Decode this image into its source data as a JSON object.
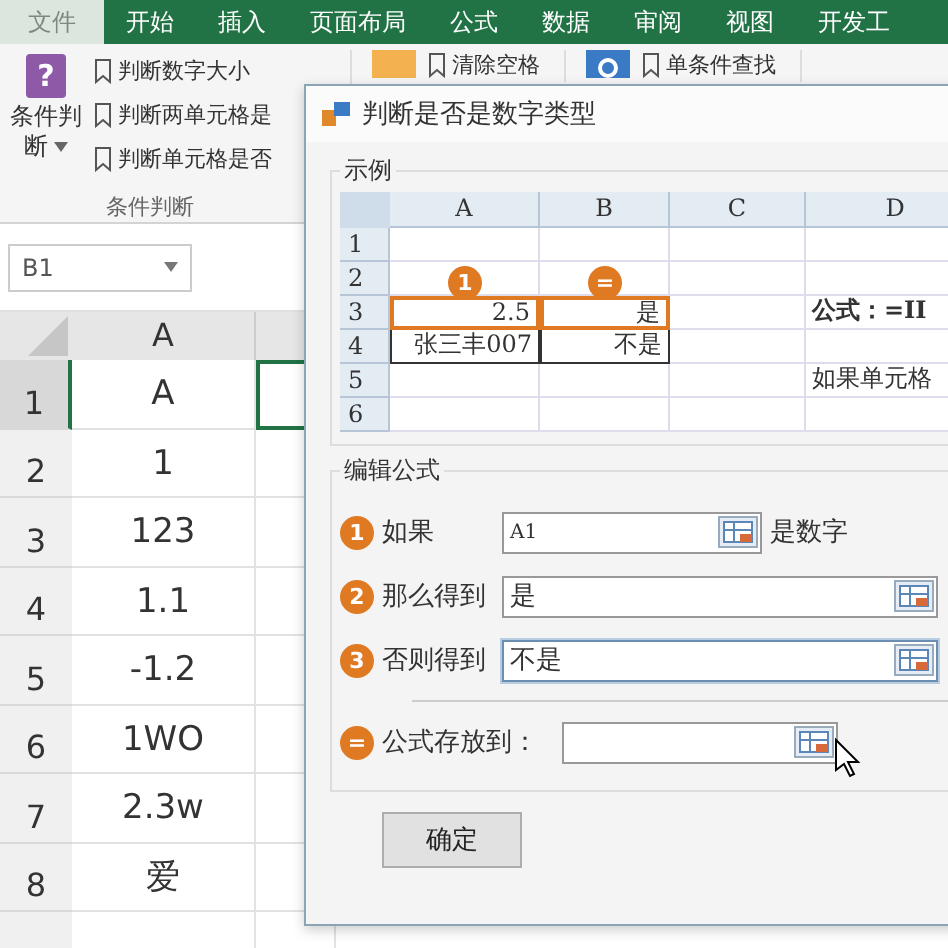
{
  "ribbon_tabs": [
    {
      "label": "文件",
      "kind": "file"
    },
    {
      "label": "开始",
      "kind": "tab"
    },
    {
      "label": "插入",
      "kind": "tab"
    },
    {
      "label": "页面布局",
      "kind": "tab"
    },
    {
      "label": "公式",
      "kind": "tab"
    },
    {
      "label": "数据",
      "kind": "tab"
    },
    {
      "label": "审阅",
      "kind": "tab"
    },
    {
      "label": "视图",
      "kind": "tab"
    },
    {
      "label": "开发工",
      "kind": "tab"
    }
  ],
  "ribbon": {
    "big_button_icon": "?",
    "big_button": "条件判断",
    "items": [
      "判断数字大小",
      "判断两单元格是",
      "判断单元格是否"
    ],
    "group_label": "条件判断",
    "tool_a": "清除空格",
    "tool_b": "单条件查找"
  },
  "name_box": "B1",
  "sheet": {
    "column": "A",
    "rows": [
      {
        "num": "1",
        "value": "A",
        "selected": true
      },
      {
        "num": "2",
        "value": "1",
        "selected": false
      },
      {
        "num": "3",
        "value": "123",
        "selected": false
      },
      {
        "num": "4",
        "value": "1.1",
        "selected": false
      },
      {
        "num": "5",
        "value": "-1.2",
        "selected": false
      },
      {
        "num": "6",
        "value": "1WO",
        "selected": false
      },
      {
        "num": "7",
        "value": "2.3w",
        "selected": false
      },
      {
        "num": "8",
        "value": "爱",
        "selected": false
      }
    ]
  },
  "dialog": {
    "title": "判断是否是数字类型",
    "example": {
      "title": "示例",
      "columns": [
        "A",
        "B",
        "C",
        "D"
      ],
      "rows": [
        {
          "num": "1",
          "cells": [
            {
              "kind": "empty"
            },
            {
              "kind": "empty"
            },
            {
              "kind": "empty"
            },
            {
              "kind": "empty"
            }
          ]
        },
        {
          "num": "2",
          "cells": [
            {
              "kind": "empty"
            },
            {
              "kind": "empty"
            },
            {
              "kind": "empty"
            },
            {
              "kind": "empty"
            }
          ]
        },
        {
          "num": "3",
          "cells": [
            {
              "text": "2.5",
              "kind": "highlight",
              "badge": "1"
            },
            {
              "text": "是",
              "kind": "highlight",
              "badge": "="
            },
            {
              "kind": "empty"
            },
            {
              "text": "公式：=II",
              "kind": "formula"
            }
          ]
        },
        {
          "num": "4",
          "cells": [
            {
              "text": "张三丰007",
              "kind": "boxed"
            },
            {
              "text": "不是",
              "kind": "boxed"
            },
            {
              "kind": "empty"
            },
            {
              "kind": "empty"
            }
          ]
        },
        {
          "num": "5",
          "cells": [
            {
              "kind": "empty"
            },
            {
              "kind": "empty"
            },
            {
              "kind": "empty"
            },
            {
              "text": "如果单元格",
              "kind": "note"
            }
          ]
        },
        {
          "num": "6",
          "cells": [
            {
              "kind": "empty"
            },
            {
              "kind": "empty"
            },
            {
              "kind": "empty"
            },
            {
              "kind": "empty"
            }
          ]
        }
      ]
    },
    "edit": {
      "title": "编辑公式",
      "rows": [
        {
          "badge": "1",
          "label": "如果",
          "value": "A1",
          "suffix": "是数字",
          "kind": "short",
          "focused": false
        },
        {
          "badge": "2",
          "label": "那么得到",
          "value": "是",
          "kind": "wide",
          "focused": false
        },
        {
          "badge": "3",
          "label": "否则得到",
          "value": "不是",
          "kind": "wide",
          "focused": true
        }
      ],
      "output": {
        "badge": "=",
        "label": "公式存放到："
      }
    },
    "ok_button": "确定"
  }
}
